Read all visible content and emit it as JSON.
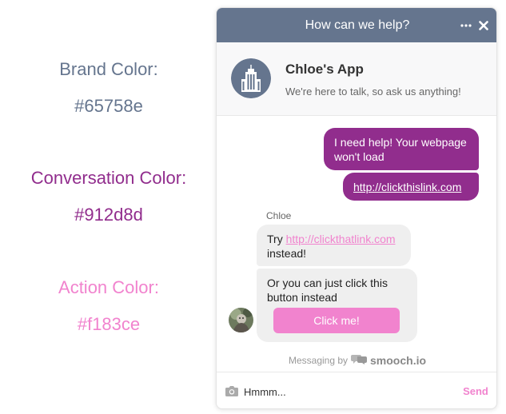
{
  "colors": {
    "brand": "#65758e",
    "conversation": "#912d8d",
    "action": "#f183ce"
  },
  "legend": {
    "brand_label": "Brand Color:",
    "brand_value": "#65758e",
    "conversation_label": "Conversation Color:",
    "conversation_value": "#912d8d",
    "action_label": "Action Color:",
    "action_value": "#f183ce"
  },
  "widget": {
    "header_title": "How can we help?",
    "header_icons": [
      "more-icon",
      "close-icon"
    ],
    "app_name": "Chloe's App",
    "app_description": "We're here to talk, so ask us anything!",
    "app_icon": "building-icon",
    "messages": {
      "user_1": "I need help! Your webpage won't load",
      "user_2_link": "http://clickthislink.com",
      "author": "Chloe",
      "app_1_prefix": "Try ",
      "app_1_link": "http://clickthatlink.com",
      "app_1_suffix": " instead!",
      "app_2": "Or you can just click this button instead",
      "app_2_button": "Click me!"
    },
    "branding_prefix": "Messaging by",
    "branding_name": "smooch.io",
    "composer": {
      "value": "Hmmm...",
      "send_label": "Send",
      "camera_icon": "camera-icon"
    }
  }
}
